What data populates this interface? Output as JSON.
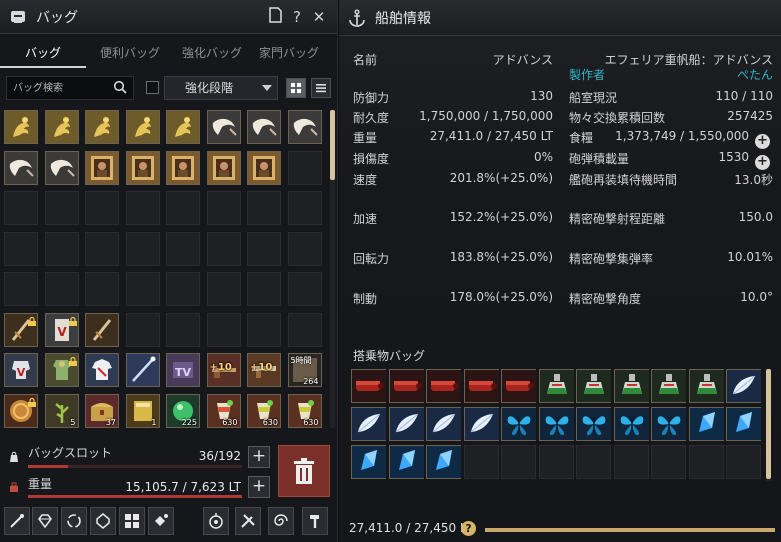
{
  "bag": {
    "title": "バッグ",
    "tabs": [
      "バッグ",
      "便利バッグ",
      "強化バッグ",
      "家門バッグ"
    ],
    "search_placeholder": "バッグ検索",
    "sort_select": "強化段階",
    "slots": "36/192",
    "slots_label": "バッグスロット",
    "slots_fill": 0.1875,
    "weight_label": "重量",
    "weight": "15,105.7 / 7,623 LT",
    "weight_fill": 1.0,
    "item_labels": {
      "time": "5時間",
      "n264": "264",
      "n5": "5",
      "n37": "37",
      "n1": "1",
      "n225": "225",
      "n630a": "630",
      "n630b": "630",
      "n630c": "630",
      "plus10a": "+10",
      "plus10b": "+10"
    }
  },
  "ship": {
    "title": "船舶情報",
    "name_label": "名前",
    "name_value": "アドバンス",
    "ship_type": "エフェリア重帆船：アドバンス",
    "maker_label": "製作者",
    "maker_value": "ぺたん",
    "left_stats": [
      {
        "k": "防御力",
        "v": "130"
      },
      {
        "k": "耐久度",
        "v": "1,750,000 / 1,750,000"
      },
      {
        "k": "重量",
        "v": "27,411.0 / 27,450 LT"
      },
      {
        "k": "損傷度",
        "v": "0%"
      },
      {
        "k": "速度",
        "v": "201.8%(+25.0%)"
      },
      {
        "k": "加速",
        "v": "152.2%(+25.0%)"
      },
      {
        "k": "回転力",
        "v": "183.8%(+25.0%)"
      },
      {
        "k": "制動",
        "v": "178.0%(+25.0%)"
      }
    ],
    "right_stats": [
      {
        "k": "船室現況",
        "v": "110 / 110"
      },
      {
        "k": "物々交換累積回数",
        "v": "257425"
      },
      {
        "k": "食糧",
        "v": "1,373,749 / 1,550,000"
      },
      {
        "k": "砲弾積載量",
        "v": "1530"
      },
      {
        "k": "艦砲再装填待機時間",
        "v": "13.0秒"
      },
      {
        "k": "精密砲撃射程距離",
        "v": "150.0"
      },
      {
        "k": "精密砲撃集弾率",
        "v": "10.01%"
      },
      {
        "k": "精密砲撃角度",
        "v": "10.0°"
      }
    ],
    "cargo_label": "搭乗物バッグ",
    "weight_text": "27,411.0 / 27,450 LT",
    "weight_fill": 0.9986,
    "help_glyph": "?"
  },
  "colors": {
    "accent_cyan": "#2fb6c6",
    "weight_red": "#b03a33",
    "gold": "#c8a86e"
  }
}
